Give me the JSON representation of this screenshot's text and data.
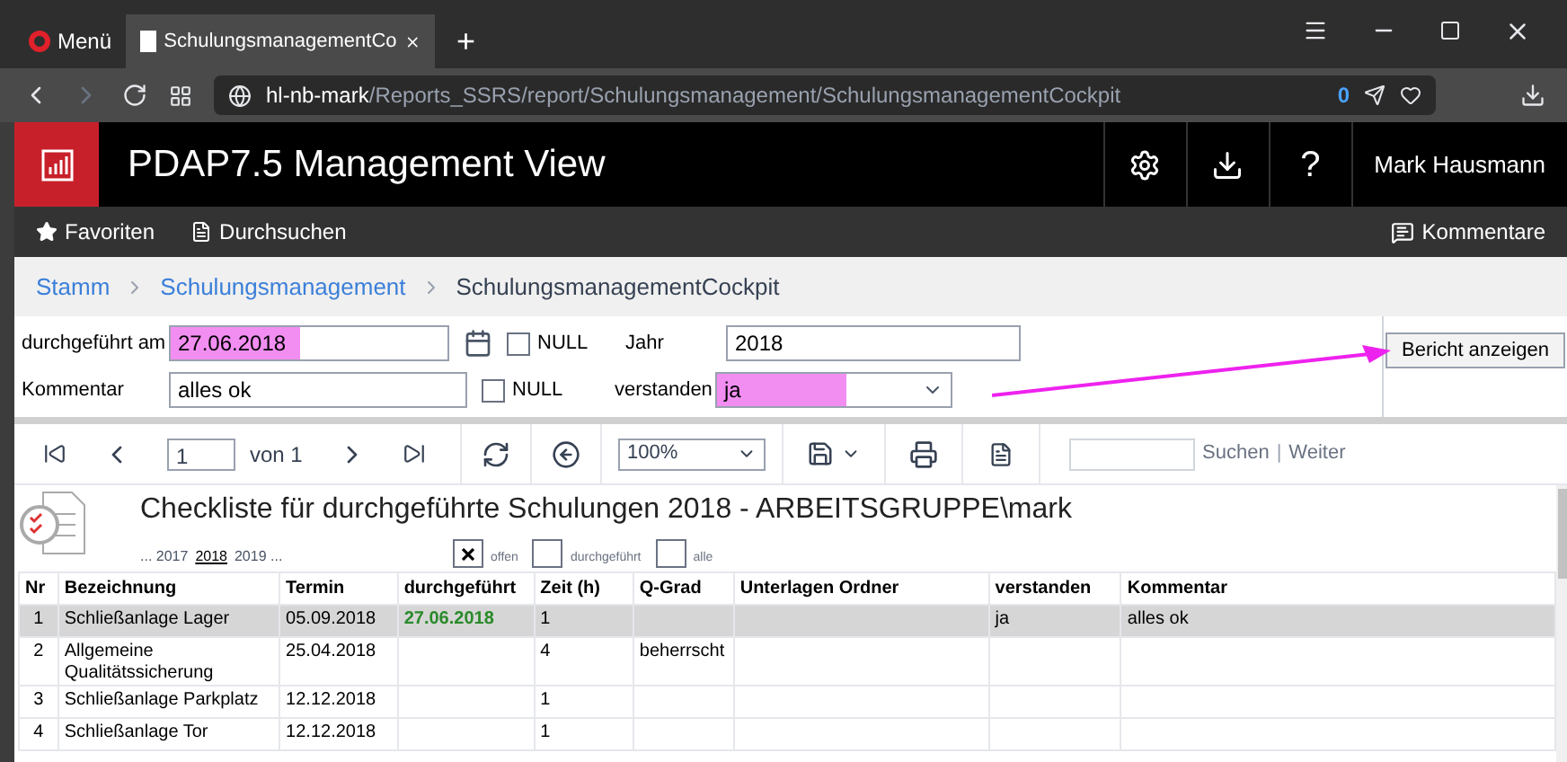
{
  "browser": {
    "menu": "Menü",
    "tab_title": "SchulungsmanagementCo",
    "new_tab": "+",
    "address_host": "hl-nb-mark",
    "address_path": "/Reports_SSRS/report/Schulungsmanagement/SchulungsmanagementCockpit",
    "blocked_count": "0"
  },
  "app": {
    "title": "PDAP7.5 Management View",
    "user": "Mark Hausmann",
    "help": "?"
  },
  "nav": {
    "favorites": "Favoriten",
    "browse": "Durchsuchen",
    "comments": "Kommentare"
  },
  "breadcrumb": [
    "Stamm",
    "Schulungsmanagement",
    "SchulungsmanagementCockpit"
  ],
  "params": [
    {
      "label": "durchgeführt am",
      "value": "27.06.2018",
      "highlighted": true,
      "kind": "date",
      "null_label": "NULL",
      "null_checked": false
    },
    {
      "label": "Jahr",
      "value": "2018",
      "highlighted": false,
      "kind": "text"
    },
    {
      "label": "Kommentar",
      "value": "alles ok",
      "highlighted": false,
      "kind": "text",
      "null_label": "NULL",
      "null_checked": false
    },
    {
      "label": "verstanden",
      "value": "ja",
      "highlighted": true,
      "kind": "select"
    }
  ],
  "view_report": "Bericht anzeigen",
  "toolbar": {
    "page": "1",
    "of": "von 1",
    "zoom": "100%",
    "search": "Suchen",
    "separator": "|",
    "next": "Weiter"
  },
  "report": {
    "title": "Checkliste für durchgeführte Schulungen 2018 - ARBEITSGRUPPE\\mark",
    "years": [
      {
        "label": "... 2017",
        "selected": false
      },
      {
        "label": "2018",
        "selected": true
      },
      {
        "label": "2019 ...",
        "selected": false
      }
    ],
    "filters": [
      {
        "label": "offen",
        "checked": true
      },
      {
        "label": "durchgeführt",
        "checked": false
      },
      {
        "label": "alle",
        "checked": false
      }
    ],
    "columns": [
      "Nr",
      "Bezeichnung",
      "Termin",
      "durchgeführt",
      "Zeit (h)",
      "Q-Grad",
      "Unterlagen Ordner",
      "verstanden",
      "Kommentar"
    ],
    "rows": [
      {
        "selected": true,
        "cells": [
          "1",
          "Schließanlage Lager",
          "05.09.2018",
          "27.06.2018",
          "1",
          "",
          "",
          "ja",
          "alles ok"
        ]
      },
      {
        "selected": false,
        "cells": [
          "2",
          "Allgemeine Qualitätssicherung",
          "25.04.2018",
          "",
          "4",
          "beherrscht",
          "",
          "",
          ""
        ]
      },
      {
        "selected": false,
        "cells": [
          "3",
          "Schließanlage Parkplatz",
          "12.12.2018",
          "",
          "1",
          "",
          "",
          "",
          ""
        ]
      },
      {
        "selected": false,
        "cells": [
          "4",
          "Schließanlage Tor",
          "12.12.2018",
          "",
          "1",
          "",
          "",
          "",
          ""
        ]
      }
    ]
  }
}
